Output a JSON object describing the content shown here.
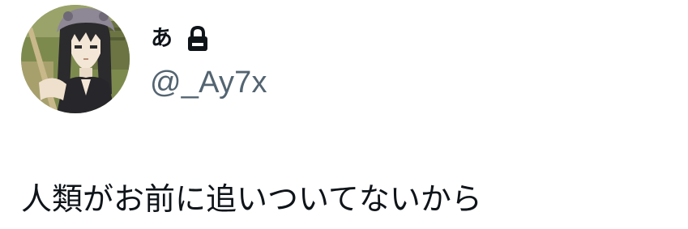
{
  "author": {
    "display_name": "あ",
    "handle": "@_Ay7x",
    "protected_icon": "lock-icon",
    "avatar": "anime-character-avatar"
  },
  "post": {
    "text": "人類がお前に追いついてないから"
  },
  "colors": {
    "text_primary": "#0f1419",
    "text_secondary": "#536471",
    "background": "#ffffff"
  }
}
